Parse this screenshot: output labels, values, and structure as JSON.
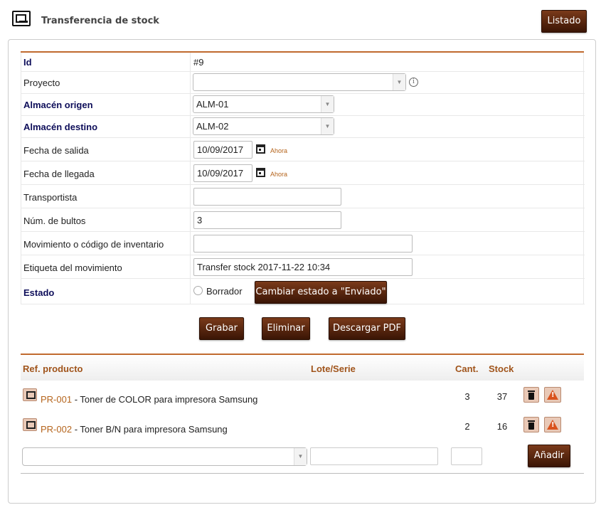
{
  "header": {
    "title": "Transferencia de stock",
    "list_button": "Listado",
    "title_icon": "stock-transfer-icon"
  },
  "form": {
    "id": {
      "label": "Id",
      "value": "#9"
    },
    "proyecto": {
      "label": "Proyecto",
      "value": ""
    },
    "almacen_origen": {
      "label": "Almacén origen",
      "value": "ALM-01"
    },
    "almacen_destino": {
      "label": "Almacén destino",
      "value": "ALM-02"
    },
    "fecha_salida": {
      "label": "Fecha de salida",
      "value": "10/09/2017",
      "now_link": "Ahora"
    },
    "fecha_llegada": {
      "label": "Fecha de llegada",
      "value": "10/09/2017",
      "now_link": "Ahora"
    },
    "transportista": {
      "label": "Transportista",
      "value": ""
    },
    "num_bultos": {
      "label": "Núm. de bultos",
      "value": "3"
    },
    "movimiento": {
      "label": "Movimiento o código de inventario",
      "value": ""
    },
    "etiqueta": {
      "label": "Etiqueta del movimiento",
      "value": "Transfer stock 2017-11-22 10:34"
    },
    "estado": {
      "label": "Estado",
      "value": "Borrador",
      "change_button": "Cambiar estado a \"Enviado\""
    }
  },
  "actions": {
    "save": "Grabar",
    "delete": "Eliminar",
    "download_pdf": "Descargar PDF"
  },
  "lines": {
    "headers": {
      "ref": "Ref. producto",
      "lot": "Lote/Serie",
      "qty": "Cant.",
      "stock": "Stock"
    },
    "rows": [
      {
        "ref": "PR-001",
        "desc": " - Toner de COLOR para impresora Samsung",
        "qty": "3",
        "stock": "37"
      },
      {
        "ref": "PR-002",
        "desc": " - Toner B/N para impresora Samsung",
        "qty": "2",
        "stock": "16"
      }
    ],
    "add_button": "Añadir"
  },
  "colors": {
    "accent": "#c06a2e",
    "button_bg": "#4a1a08",
    "required_label": "#0e0e5a",
    "link": "#b5651d"
  }
}
